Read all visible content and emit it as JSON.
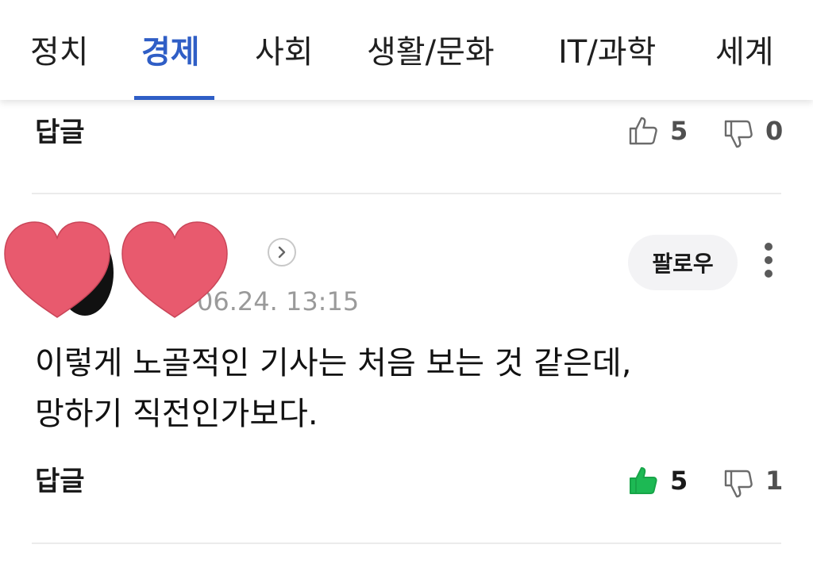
{
  "tabs": [
    {
      "label": "정치",
      "active": false
    },
    {
      "label": "경제",
      "active": true
    },
    {
      "label": "사회",
      "active": false
    },
    {
      "label": "생활/문화",
      "active": false
    },
    {
      "label": "IT/과학",
      "active": false
    },
    {
      "label": "세계",
      "active": false
    }
  ],
  "previous_comment": {
    "reply_label": "답글",
    "likes": "5",
    "dislikes": "0"
  },
  "comment": {
    "username": "**",
    "timestamp": "06.24. 13:15",
    "follow_label": "팔로우",
    "body_lines": [
      "이렇게 노골적인 기사는 처음 보는 것 같은데,",
      "망하기 직전인가보다."
    ],
    "reply_label": "답글",
    "likes": "5",
    "dislikes": "1",
    "liked": true
  },
  "colors": {
    "accent": "#2f5ec6",
    "like_active": "#1db954",
    "heart": "#e85a6e"
  },
  "icons": [
    "thumbs-up-icon",
    "thumbs-down-icon",
    "chevron-right-icon",
    "more-vertical-icon",
    "heart-sticker"
  ]
}
